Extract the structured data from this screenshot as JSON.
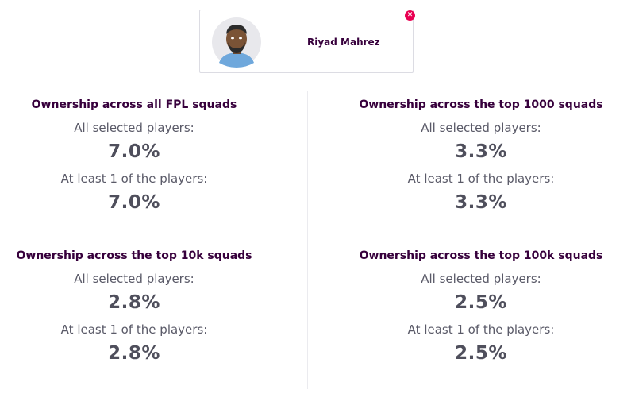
{
  "player": {
    "name": "Riyad Mahrez",
    "remove_icon": "close-icon"
  },
  "blocks": [
    {
      "title": "Ownership across all FPL squads",
      "all_selected_label": "All selected players:",
      "all_selected_value": "7.0%",
      "at_least_one_label": "At least 1 of the players:",
      "at_least_one_value": "7.0%"
    },
    {
      "title": "Ownership across the top 1000 squads",
      "all_selected_label": "All selected players:",
      "all_selected_value": "3.3%",
      "at_least_one_label": "At least 1 of the players:",
      "at_least_one_value": "3.3%"
    },
    {
      "title": "Ownership across the top 10k squads",
      "all_selected_label": "All selected players:",
      "all_selected_value": "2.8%",
      "at_least_one_label": "At least 1 of the players:",
      "at_least_one_value": "2.8%"
    },
    {
      "title": "Ownership across the top 100k squads",
      "all_selected_label": "All selected players:",
      "all_selected_value": "2.5%",
      "at_least_one_label": "At least 1 of the players:",
      "at_least_one_value": "2.5%"
    }
  ],
  "colors": {
    "title": "#37003c",
    "remove": "#e90052"
  }
}
